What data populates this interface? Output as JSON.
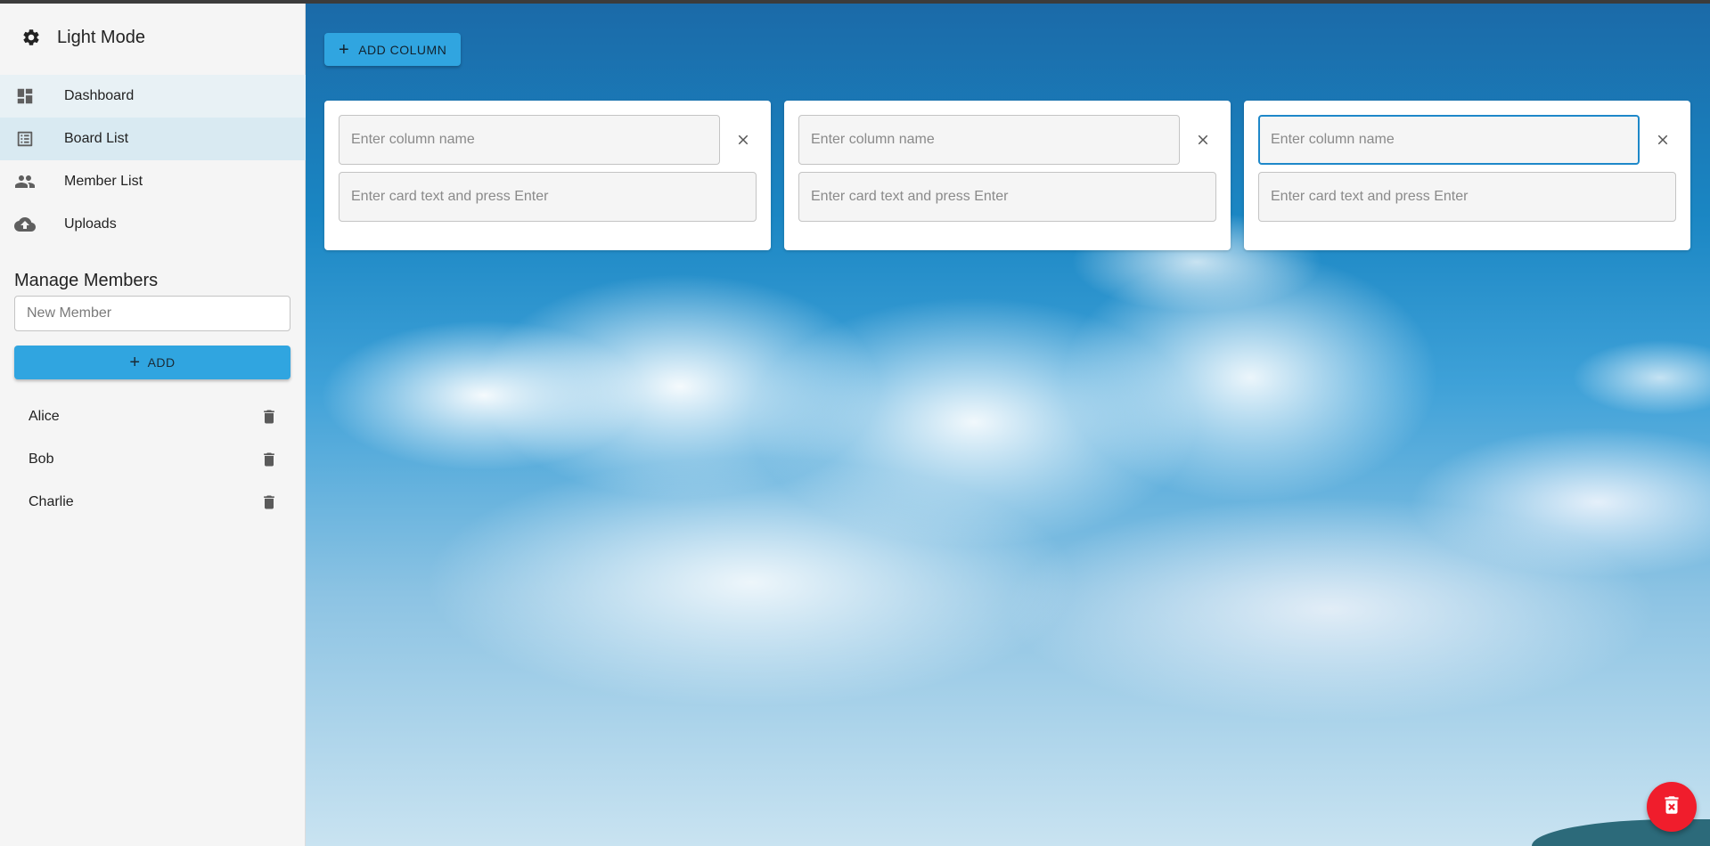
{
  "sidebar": {
    "mode": {
      "label": "Light Mode",
      "icon": "gear-icon"
    },
    "nav": [
      {
        "label": "Dashboard",
        "icon": "dashboard-icon"
      },
      {
        "label": "Board List",
        "icon": "list-alt-icon"
      },
      {
        "label": "Member List",
        "icon": "people-icon"
      },
      {
        "label": "Uploads",
        "icon": "cloud-upload-icon"
      }
    ],
    "manage_members": {
      "title": "Manage Members",
      "input_placeholder": "New Member",
      "add_label": "ADD",
      "members": [
        "Alice",
        "Bob",
        "Charlie"
      ]
    }
  },
  "main": {
    "add_column_label": "ADD COLUMN",
    "columns": [
      {
        "name_placeholder": "Enter column name",
        "card_placeholder": "Enter card text and press Enter"
      },
      {
        "name_placeholder": "Enter column name",
        "card_placeholder": "Enter card text and press Enter"
      },
      {
        "name_placeholder": "Enter column name",
        "card_placeholder": "Enter card text and press Enter"
      }
    ],
    "fab_icon": "delete-forever-icon"
  },
  "colors": {
    "accent": "#30a5e0",
    "danger": "#f01d2c",
    "sidebar_bg": "#f5f5f5",
    "focus_border": "#1e88c9"
  }
}
